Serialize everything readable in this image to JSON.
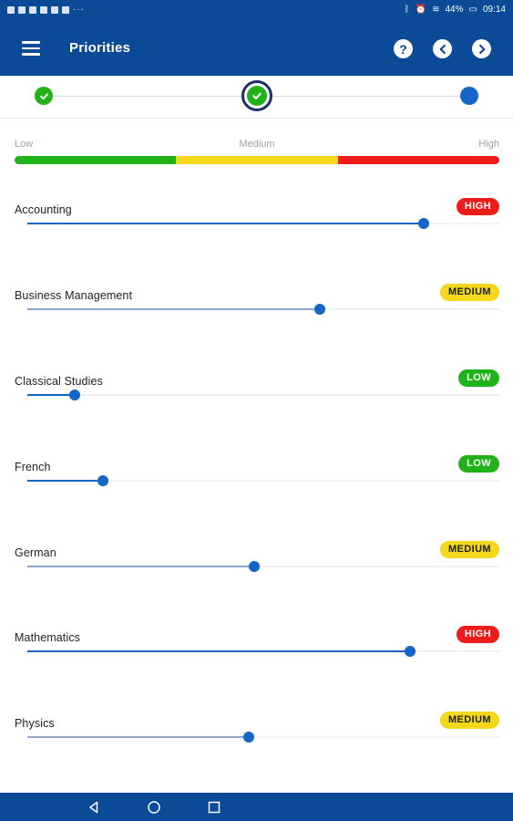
{
  "status_bar": {
    "battery": "44%",
    "time": "09:14"
  },
  "app_bar": {
    "title": "Priorities",
    "icons": [
      "menu-icon",
      "help-icon",
      "chevron-left-icon",
      "chevron-right-icon"
    ]
  },
  "stepper": {
    "steps": [
      "done",
      "current",
      "upcoming"
    ]
  },
  "legend": {
    "low": "Low",
    "medium": "Medium",
    "high": "High"
  },
  "colors": {
    "primary": "#0a4a96",
    "thumb": "#1565c7",
    "low": "#21b21a",
    "medium": "#f3d81d",
    "high": "#ee1b1b",
    "fill_high_low": "#1565c7",
    "fill_medium": "#8ea6c9"
  },
  "subjects": [
    {
      "name": "Accounting",
      "level": "HIGH",
      "value": 0.84
    },
    {
      "name": "Business Management",
      "level": "MEDIUM",
      "value": 0.62
    },
    {
      "name": "Classical Studies",
      "level": "LOW",
      "value": 0.1
    },
    {
      "name": "French",
      "level": "LOW",
      "value": 0.16
    },
    {
      "name": "German",
      "level": "MEDIUM",
      "value": 0.48
    },
    {
      "name": "Mathematics",
      "level": "HIGH",
      "value": 0.81
    },
    {
      "name": "Physics",
      "level": "MEDIUM",
      "value": 0.47
    }
  ]
}
